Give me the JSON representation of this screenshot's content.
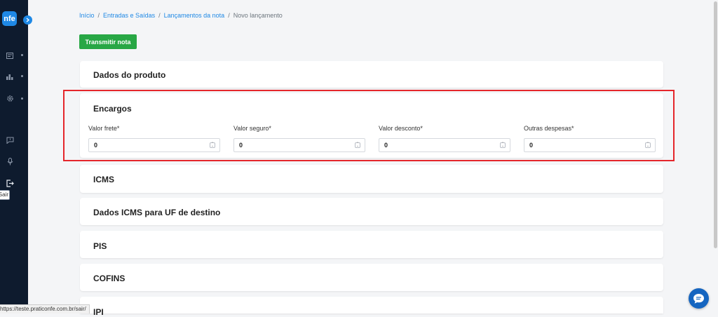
{
  "sidebar": {
    "logo_text": "nfe",
    "expand_icon": "chevron-right-icon",
    "items": [
      {
        "icon": "file-icon"
      },
      {
        "icon": "chart-icon"
      },
      {
        "icon": "gear-icon"
      },
      {
        "icon": "chat-icon"
      },
      {
        "icon": "microphone-icon"
      },
      {
        "icon": "logout-icon"
      }
    ],
    "tooltip": "Sair"
  },
  "breadcrumb": {
    "items": [
      "Início",
      "Entradas e Saídas",
      "Lançamentos da nota"
    ],
    "current": "Novo lançamento",
    "separator": "/"
  },
  "toolbar": {
    "transmit_label": "Transmitir nota"
  },
  "sections": {
    "produto": "Dados do produto",
    "encargos": "Encargos",
    "icms": "ICMS",
    "icms_uf": "Dados ICMS para UF de destino",
    "pis": "PIS",
    "cofins": "COFINS",
    "ipi": "IPI"
  },
  "encargos_fields": [
    {
      "label": "Valor frete*",
      "value": "0"
    },
    {
      "label": "Valor seguro*",
      "value": "0"
    },
    {
      "label": "Valor desconto*",
      "value": "0"
    },
    {
      "label": "Outras despesas*",
      "value": "0"
    }
  ],
  "status_url": "https://teste.praticonfe.com.br/sair/",
  "colors": {
    "accent": "#1e88e5",
    "success": "#28a745",
    "highlight": "#e5262b",
    "sidebar": "#0e1b2e"
  }
}
